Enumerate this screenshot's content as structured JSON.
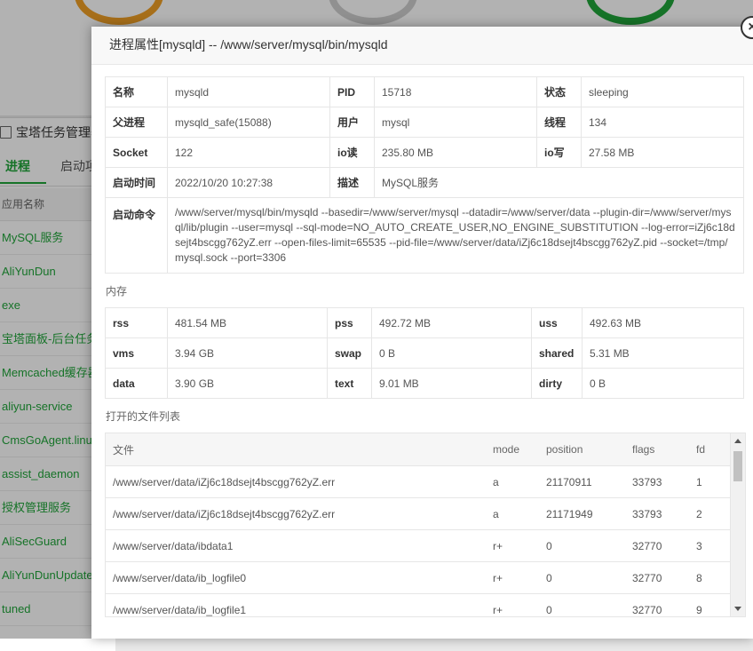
{
  "background": {
    "window_title": "宝塔任务管理器",
    "tabs": [
      "进程",
      "启动项"
    ],
    "column_header": "应用名称",
    "apps": [
      "MySQL服务",
      "AliYunDun",
      "exe",
      "宝塔面板-后台任务",
      "Memcached缓存器",
      "aliyun-service",
      "CmsGoAgent.linux",
      "assist_daemon",
      "授权管理服务",
      "AliSecGuard",
      "AliYunDunUpdate",
      "tuned"
    ]
  },
  "dialog": {
    "title": "进程属性[mysqld] -- /www/server/mysql/bin/mysqld",
    "close_icon": "×",
    "info": {
      "name_label": "名称",
      "name": "mysqld",
      "pid_label": "PID",
      "pid": "15718",
      "status_label": "状态",
      "status": "sleeping",
      "parent_label": "父进程",
      "parent": "mysqld_safe(15088)",
      "user_label": "用户",
      "user": "mysql",
      "threads_label": "线程",
      "threads": "134",
      "socket_label": "Socket",
      "socket": "122",
      "io_read_label": "io读",
      "io_read": "235.80 MB",
      "io_write_label": "io写",
      "io_write": "27.58 MB",
      "start_time_label": "启动时间",
      "start_time": "2022/10/20 10:27:38",
      "desc_label": "描述",
      "desc": "MySQL服务",
      "cmd_label": "启动命令",
      "cmd": "/www/server/mysql/bin/mysqld --basedir=/www/server/mysql --datadir=/www/server/data --plugin-dir=/www/server/mysql/lib/plugin --user=mysql --sql-mode=NO_AUTO_CREATE_USER,NO_ENGINE_SUBSTITUTION --log-error=iZj6c18dsejt4bscgg762yZ.err --open-files-limit=65535 --pid-file=/www/server/data/iZj6c18dsejt4bscgg762yZ.pid --socket=/tmp/mysql.sock --port=3306"
    },
    "memory": {
      "section_title": "内存",
      "rss_label": "rss",
      "rss": "481.54 MB",
      "pss_label": "pss",
      "pss": "492.72 MB",
      "uss_label": "uss",
      "uss": "492.63 MB",
      "vms_label": "vms",
      "vms": "3.94 GB",
      "swap_label": "swap",
      "swap": "0 B",
      "shared_label": "shared",
      "shared": "5.31 MB",
      "data_label": "data",
      "data": "3.90 GB",
      "text_label": "text",
      "text": "9.01 MB",
      "dirty_label": "dirty",
      "dirty": "0 B"
    },
    "files": {
      "section_title": "打开的文件列表",
      "headers": [
        "文件",
        "mode",
        "position",
        "flags",
        "fd"
      ],
      "rows": [
        [
          "/www/server/data/iZj6c18dsejt4bscgg762yZ.err",
          "a",
          "21170911",
          "33793",
          "1"
        ],
        [
          "/www/server/data/iZj6c18dsejt4bscgg762yZ.err",
          "a",
          "21171949",
          "33793",
          "2"
        ],
        [
          "/www/server/data/ibdata1",
          "r+",
          "0",
          "32770",
          "3"
        ],
        [
          "/www/server/data/ib_logfile0",
          "r+",
          "0",
          "32770",
          "8"
        ],
        [
          "/www/server/data/ib_logfile1",
          "r+",
          "0",
          "32770",
          "9"
        ]
      ]
    }
  }
}
